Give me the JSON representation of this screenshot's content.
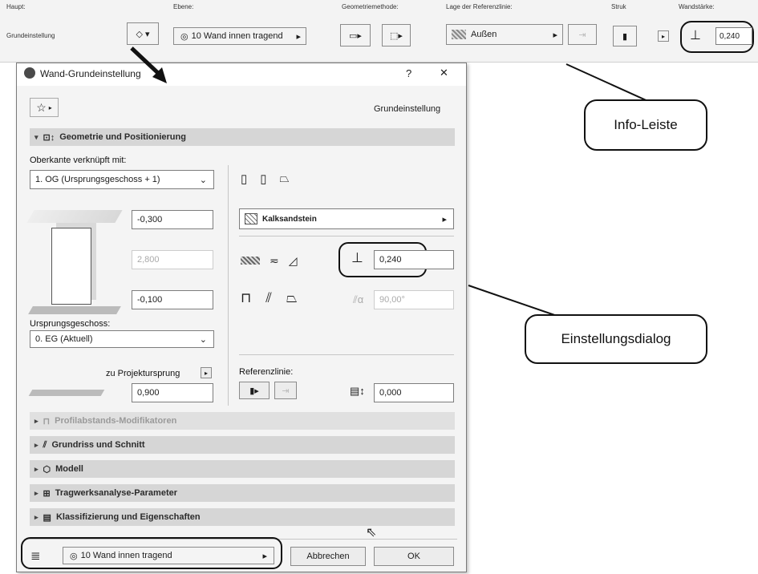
{
  "infobar": {
    "haupt_label": "Haupt:",
    "haupt_value": "Grundeinstellung",
    "ebene_label": "Ebene:",
    "ebene_value": "10 Wand innen tragend",
    "geometrie_label": "Geometriemethode:",
    "referenz_label": "Lage der Referenzlinie:",
    "referenz_value": "Außen",
    "struk_label": "Struk",
    "wandstaerke_label": "Wandstärke:",
    "wandstaerke_value": "0,240"
  },
  "dialog": {
    "title": "Wand-Grundeinstellung",
    "help": "?",
    "close": "✕",
    "preset_name": "Grundeinstellung",
    "geometry_section": "Geometrie und Positionierung",
    "oberkante_label": "Oberkante verknüpft mit:",
    "oberkante_value": "1. OG (Ursprungsgeschoss + 1)",
    "top_offset": "-0,300",
    "height": "2,800",
    "bottom_offset": "-0,100",
    "material": "Kalksandstein",
    "thickness": "0,240",
    "angle": "90,00°",
    "ursprung_label": "Ursprungsgeschoss:",
    "ursprung_value": "0. EG (Aktuell)",
    "projekt_label": "zu Projektursprung",
    "projekt_value": "0,900",
    "referenz_label": "Referenzlinie:",
    "referenz_offset": "0,000",
    "sections": [
      "Profilabstands-Modifikatoren",
      "Grundriss und Schnitt",
      "Modell",
      "Tragwerksanalyse-Parameter",
      "Klassifizierung und Eigenschaften"
    ],
    "footer_layer": "10 Wand innen tragend",
    "cancel": "Abbrechen",
    "ok": "OK"
  },
  "callouts": {
    "info": "Info-Leiste",
    "settings": "Einstellungsdialog"
  }
}
